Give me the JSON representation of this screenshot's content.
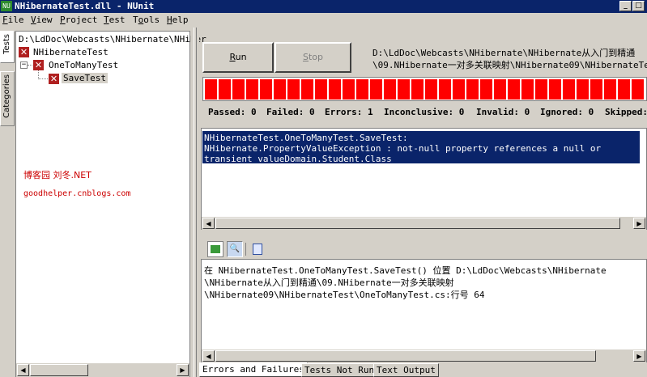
{
  "window": {
    "title": "NHibernateTest.dll - NUnit",
    "app_icon_text": "NU"
  },
  "menu": [
    {
      "prefix": "",
      "accel": "F",
      "rest": "ile"
    },
    {
      "prefix": "",
      "accel": "V",
      "rest": "iew"
    },
    {
      "prefix": "",
      "accel": "P",
      "rest": "roject"
    },
    {
      "prefix": "",
      "accel": "T",
      "rest": "est"
    },
    {
      "prefix": "T",
      "accel": "o",
      "rest": "ols"
    },
    {
      "prefix": "",
      "accel": "H",
      "rest": "elp"
    }
  ],
  "side_tabs": {
    "tests": "Tests",
    "categories": "Categories"
  },
  "tree": {
    "path": "D:\\LdDoc\\Webcasts\\NHibernate\\NHiber",
    "nodes": [
      {
        "label": "NHibernateTest",
        "status": "failed"
      },
      {
        "label": "OneToManyTest",
        "status": "failed"
      },
      {
        "label": "SaveTest",
        "status": "failed"
      }
    ],
    "watermark_1": "博客园  刘冬.NET",
    "watermark_2": "goodhelper.cnblogs.com"
  },
  "buttons": {
    "run_accel": "R",
    "run_rest": "un",
    "stop_accel": "S",
    "stop_rest": "top"
  },
  "run_path": {
    "line1": "D:\\LdDoc\\Webcasts\\NHibernate\\NHibernate从入门到精通",
    "line2": "\\09.NHibernate一对多关联映射\\NHibernate09\\NHibernateTes"
  },
  "progress": {
    "fraction": 1.0,
    "color": "#ff0000"
  },
  "stats": {
    "passed": "Passed: 0",
    "failed": "Failed: 0",
    "errors": "Errors: 1",
    "inconclusive": "Inconclusive: 0",
    "invalid": "Invalid: 0",
    "ignored": "Ignored: 0",
    "skipped": "Skipped:"
  },
  "error": {
    "line1": "NHibernateTest.OneToManyTest.SaveTest:",
    "line2": "NHibernate.PropertyValueException : not-null property references a null or",
    "line3": "transient valueDomain.Student.Class"
  },
  "stack_trace": {
    "line1": "在 NHibernateTest.OneToManyTest.SaveTest() 位置 D:\\LdDoc\\Webcasts\\NHibernate",
    "line2": "\\NHibernate从入门到精通\\09.NHibernate一对多关联映射",
    "line3": "\\NHibernate09\\NHibernateTest\\OneToManyTest.cs:行号 64"
  },
  "bottom_tabs": [
    "Errors and Failures",
    "Tests Not Run",
    "Text Output"
  ]
}
